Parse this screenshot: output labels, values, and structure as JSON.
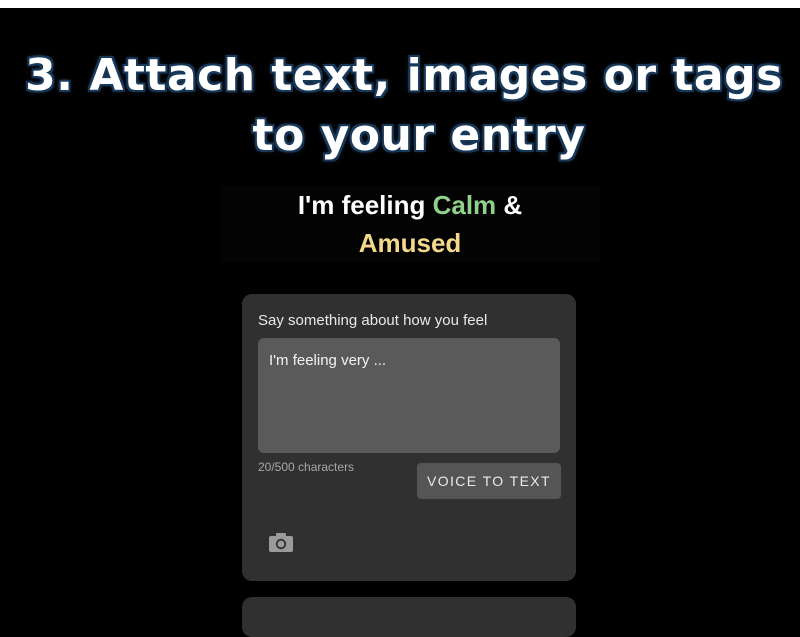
{
  "headline": {
    "line1": "3. Attach text, images or tags",
    "line2": "to your entry"
  },
  "feeling": {
    "prefix": "I'm feeling ",
    "emotion1": "Calm",
    "joiner": " &",
    "emotion2": "Amused",
    "emotion1_color": "#8fd18a",
    "emotion2_color": "#f4d98b"
  },
  "entry_card": {
    "label": "Say something about how you feel",
    "text_value": "I'm feeling very ...",
    "char_count": "20/500 characters",
    "voice_button": "VOICE TO TEXT",
    "camera_icon": "camera-icon"
  }
}
